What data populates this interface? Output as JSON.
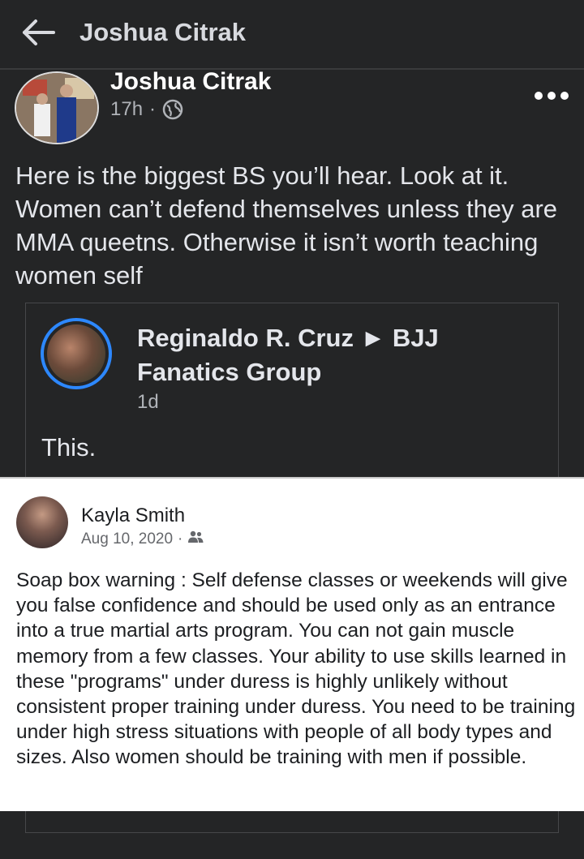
{
  "header": {
    "title": "Joshua Citrak"
  },
  "post": {
    "author": "Joshua Citrak",
    "time": "17h",
    "separator": "·",
    "text": "Here is the biggest BS you’ll hear. Look at it. Women can’t defend themselves unless they are MMA queetns. Otherwise it isn’t worth teaching women self"
  },
  "shared_post": {
    "author_line": "Reginaldo R. Cruz ► BJJ Fanatics Group",
    "time": "1d",
    "text": "This."
  },
  "embedded_screenshot": {
    "author": "Kayla Smith",
    "date": "Aug 10, 2020",
    "separator": "·",
    "text": "Soap box warning : Self defense classes or weekends will give you false confidence and should be used only as an entrance into a true martial arts program. You can not gain muscle memory from a few classes. Your ability to use skills learned in these \"programs\" under duress is highly unlikely without consistent proper training under duress. You need to be training under high stress situations with people of all body types and sizes. Also women should be training with men if possible."
  },
  "icons": {
    "back": "back-arrow-icon",
    "more": "more-options-icon",
    "privacy": "globe-icon",
    "audience": "friends-icon"
  },
  "colors": {
    "background": "#242526",
    "text": "#e4e6eb",
    "secondary_text": "#b0b3b8",
    "accent_ring": "#2d88ff"
  }
}
